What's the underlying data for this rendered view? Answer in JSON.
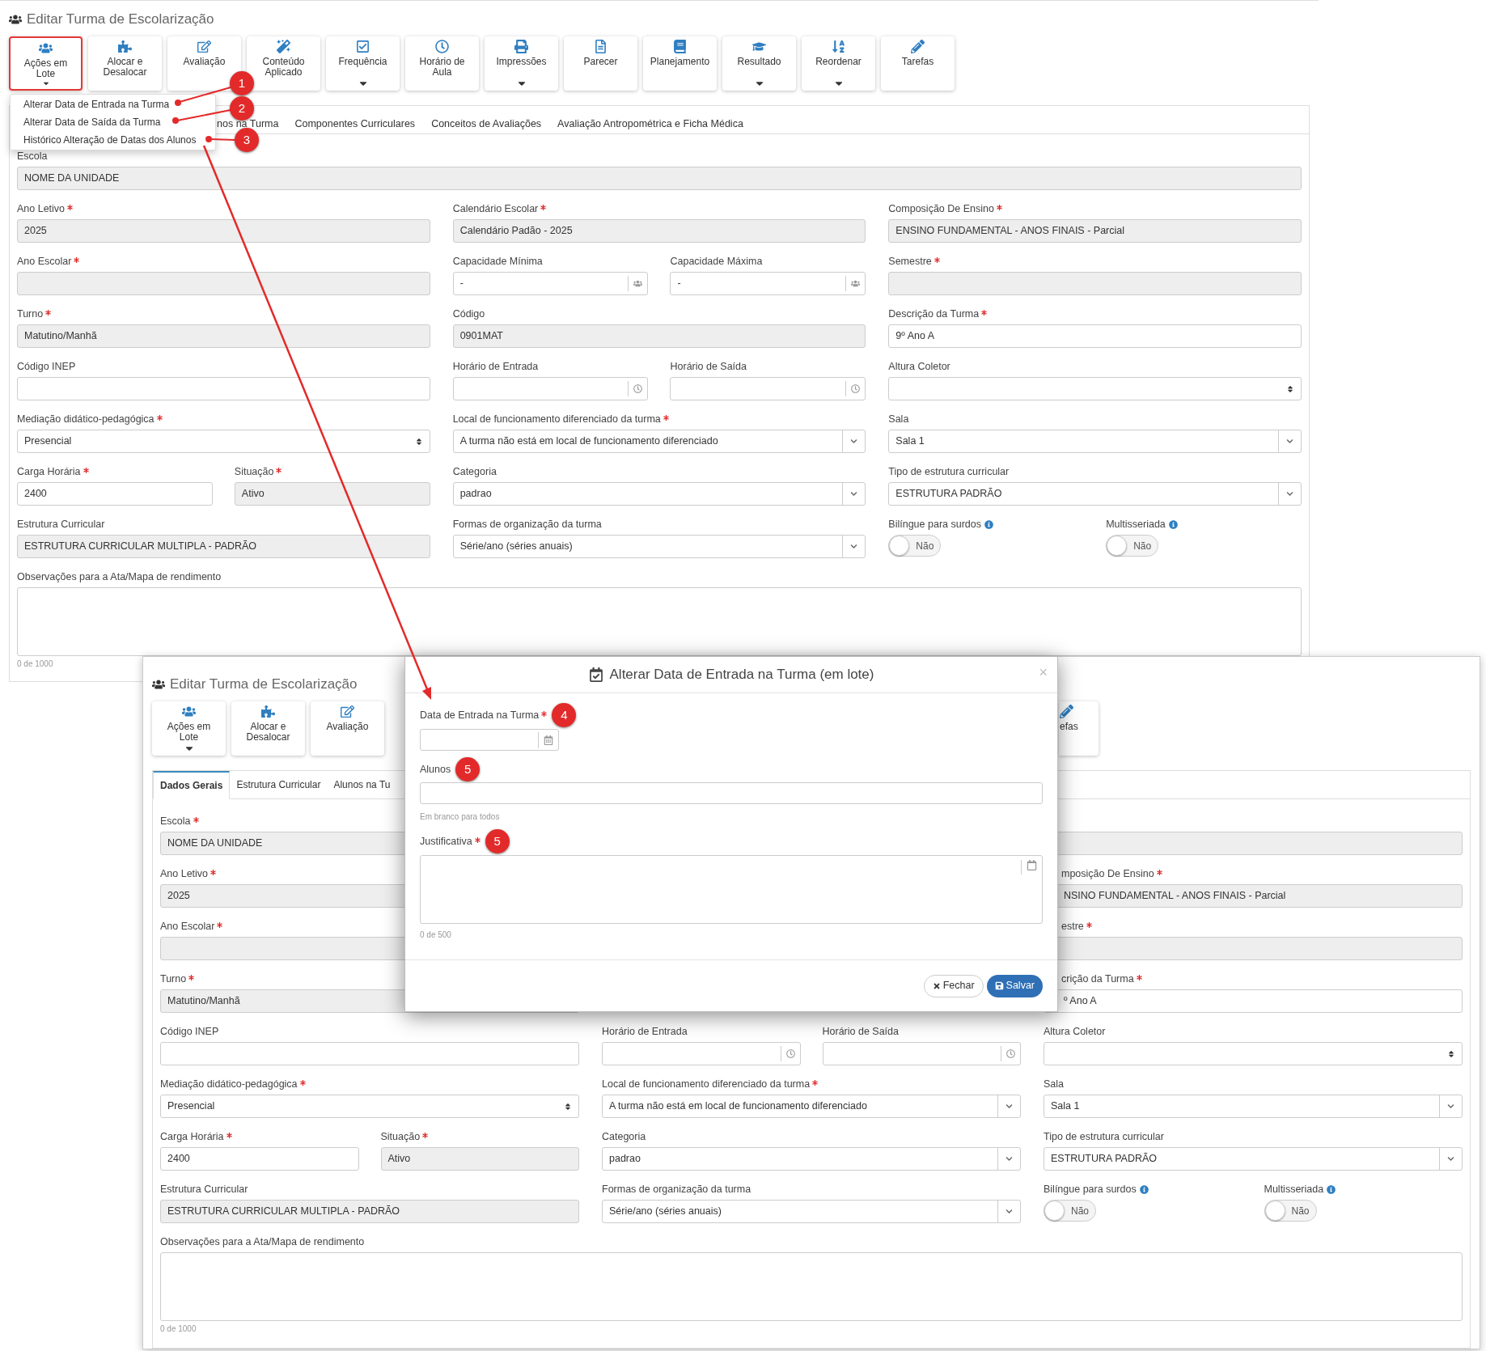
{
  "screens": [
    {
      "title": "Editar Turma de Escolarização",
      "toolbar": [
        {
          "label": "Ações em Lote",
          "dropdown": true,
          "highlighted": true
        },
        {
          "label": "Alocar e Desalocar",
          "dropdown": false,
          "highlighted": false
        },
        {
          "label": "Avaliação",
          "dropdown": false,
          "highlighted": false
        },
        {
          "label": "Conteúdo Aplicado",
          "dropdown": false,
          "highlighted": false
        },
        {
          "label": "Frequência",
          "dropdown": true,
          "highlighted": false
        },
        {
          "label": "Horário de Aula",
          "dropdown": false,
          "highlighted": false
        },
        {
          "label": "Impressões",
          "dropdown": true,
          "highlighted": false
        },
        {
          "label": "Parecer",
          "dropdown": false,
          "highlighted": false
        },
        {
          "label": "Planejamento",
          "dropdown": false,
          "highlighted": false
        },
        {
          "label": "Resultado",
          "dropdown": true,
          "highlighted": false
        },
        {
          "label": "Reordenar",
          "dropdown": true,
          "highlighted": false
        },
        {
          "label": "Tarefas",
          "dropdown": false,
          "highlighted": false
        }
      ],
      "menu": {
        "items": [
          "Alterar Data de Entrada na Turma",
          "Alterar Data de Saída da Turma",
          "Histórico Alteração de Datas dos Alunos"
        ]
      },
      "tabs": [
        {
          "label": "nos na Turma",
          "selected": false
        },
        {
          "label": "Componentes Curriculares",
          "selected": false
        },
        {
          "label": "Conceitos de Avaliações",
          "selected": false
        },
        {
          "label": "Avaliação Antropométrica e Ficha Médica",
          "selected": false
        }
      ],
      "escola": {
        "label": "Escola",
        "required": false,
        "kind": "input",
        "value": "NOME DA UNIDADE",
        "disabled": true
      },
      "rows": [
        {
          "col1": [
            {
              "label": "Ano Letivo",
              "required": true,
              "kind": "input",
              "value": "2025",
              "disabled": true
            }
          ],
          "col2": [
            {
              "label": "Calendário Escolar",
              "required": true,
              "kind": "input",
              "value": "Calendário Padão - 2025",
              "disabled": true
            }
          ],
          "col3": [
            {
              "label": "Composição De Ensino",
              "required": true,
              "kind": "input",
              "value": "ENSINO FUNDAMENTAL - ANOS FINAIS - Parcial",
              "disabled": true
            }
          ]
        },
        {
          "col1": [
            {
              "label": "Ano Escolar",
              "required": true,
              "kind": "input",
              "disabled": true
            }
          ],
          "col2": [
            {
              "label": "Capacidade Mínima",
              "required": false,
              "kind": "people",
              "value": "-",
              "disabled": false
            },
            {
              "label": "Capacidade Máxima",
              "required": false,
              "kind": "people",
              "value": "-",
              "disabled": false
            }
          ],
          "col3": [
            {
              "label": "Semestre",
              "required": true,
              "kind": "input",
              "disabled": true
            }
          ]
        },
        {
          "col1": [
            {
              "label": "Turno",
              "required": true,
              "kind": "input",
              "value": "Matutino/Manhã",
              "disabled": true
            }
          ],
          "col2": [
            {
              "label": "Código",
              "required": false,
              "kind": "input",
              "value": "0901MAT",
              "disabled": true
            }
          ],
          "col3": [
            {
              "label": "Descrição da Turma",
              "required": true,
              "kind": "input",
              "value": "9º Ano A",
              "disabled": false
            }
          ]
        },
        {
          "col1": [
            {
              "label": "Código INEP",
              "required": false,
              "kind": "input",
              "disabled": false
            }
          ],
          "col2": [
            {
              "label": "Horário de Entrada",
              "required": false,
              "kind": "clock",
              "disabled": false
            },
            {
              "label": "Horário de Saída",
              "required": false,
              "kind": "clock",
              "disabled": false
            }
          ],
          "col3": [
            {
              "label": "Altura Coletor",
              "required": false,
              "kind": "spinner",
              "disabled": false
            }
          ]
        },
        {
          "col1": [
            {
              "label": "Mediação didático-pedagógica",
              "required": true,
              "kind": "spinner",
              "value": "Presencial",
              "disabled": false
            }
          ],
          "col2": [
            {
              "label": "Local de funcionamento diferenciado da turma",
              "required": true,
              "kind": "select",
              "value": "A turma não está em local de funcionamento diferenciado",
              "disabled": false
            }
          ],
          "col3": [
            {
              "label": "Sala",
              "required": false,
              "kind": "select",
              "value": "Sala 1",
              "disabled": false
            }
          ]
        },
        {
          "col1": [
            {
              "label": "Carga Horária",
              "required": true,
              "kind": "input",
              "value": "2400",
              "disabled": false
            },
            {
              "label": "Situação",
              "required": true,
              "kind": "input",
              "value": "Ativo",
              "disabled": true
            }
          ],
          "col2": [
            {
              "label": "Categoria",
              "required": false,
              "kind": "select",
              "value": "padrao",
              "disabled": false
            }
          ],
          "col3": [
            {
              "label": "Tipo de estrutura curricular",
              "required": false,
              "kind": "select",
              "value": "ESTRUTURA PADRÃO",
              "disabled": false
            }
          ]
        },
        {
          "col1": [
            {
              "label": "Estrutura Curricular",
              "required": false,
              "kind": "input",
              "value": "ESTRUTURA CURRICULAR MULTIPLA - PADRÃO",
              "disabled": true
            }
          ],
          "col2": [
            {
              "label": "Formas de organização da turma",
              "required": false,
              "kind": "select",
              "value": "Série/ano (séries anuais)",
              "disabled": false
            }
          ],
          "col3": [
            {
              "label": "Bilíngue para surdos",
              "required": false,
              "info": true,
              "kind": "toggle",
              "value": "Não",
              "on": false
            },
            {
              "label": "Multisseriada",
              "required": false,
              "info": true,
              "kind": "toggle",
              "value": "Não",
              "on": false
            }
          ]
        }
      ],
      "observacoes": {
        "label": "Observações para a Ata/Mapa de rendimento",
        "required": false,
        "kind": "textarea",
        "counter": "0 de 1000"
      }
    },
    {
      "title": "Editar Turma de Escolarização",
      "toolbar": [
        {
          "label": "Ações em Lote",
          "dropdown": true,
          "highlighted": false
        },
        {
          "label": "Alocar e Desalocar",
          "dropdown": false,
          "highlighted": false
        },
        {
          "label": "Avaliação",
          "dropdown": false,
          "highlighted": false
        },
        {
          "label": "efas",
          "dropdown": false,
          "highlighted": false
        }
      ],
      "tabs": [
        {
          "label": "Dados Gerais",
          "selected": true
        },
        {
          "label": "Estrutura Curricular",
          "selected": false
        },
        {
          "label": "Alunos na Tu",
          "selected": false
        }
      ],
      "escola": {
        "label": "Escola",
        "required": true,
        "kind": "input",
        "value": "NOME DA UNIDADE",
        "disabled": true
      },
      "rows": [
        {
          "col1": [
            {
              "label": "Ano Letivo",
              "required": true,
              "kind": "input",
              "value": "2025",
              "disabled": true
            }
          ],
          "col3": [
            {
              "label": "mposição De Ensino",
              "required": true,
              "kind": "input",
              "value": "NSINO FUNDAMENTAL - ANOS FINAIS - Parcial",
              "disabled": true
            }
          ]
        },
        {
          "col1": [
            {
              "label": "Ano Escolar",
              "required": true,
              "kind": "input",
              "disabled": true
            }
          ],
          "col3": [
            {
              "label": "estre",
              "required": true,
              "kind": "input",
              "disabled": true
            }
          ]
        },
        {
          "col1": [
            {
              "label": "Turno",
              "required": true,
              "kind": "input",
              "value": "Matutino/Manhã",
              "disabled": true
            }
          ],
          "col3": [
            {
              "label": "crição da Turma",
              "required": true,
              "kind": "input",
              "value": "º Ano A",
              "disabled": false
            }
          ]
        },
        {
          "col1": [
            {
              "label": "Código INEP",
              "required": false,
              "kind": "input",
              "disabled": false
            }
          ],
          "col2": [
            {
              "label": "Horário de Entrada",
              "required": false,
              "kind": "clock",
              "disabled": false
            },
            {
              "label": "Horário de Saída",
              "required": false,
              "kind": "clock",
              "disabled": false
            }
          ],
          "col3": [
            {
              "label": "Altura Coletor",
              "required": false,
              "kind": "spinner",
              "disabled": false
            }
          ]
        },
        {
          "col1": [
            {
              "label": "Mediação didático-pedagógica",
              "required": true,
              "kind": "spinner",
              "value": "Presencial",
              "disabled": false
            }
          ],
          "col2": [
            {
              "label": "Local de funcionamento diferenciado da turma",
              "required": true,
              "kind": "select",
              "value": "A turma não está em local de funcionamento diferenciado",
              "disabled": false
            }
          ],
          "col3": [
            {
              "label": "Sala",
              "required": false,
              "kind": "select",
              "value": "Sala 1",
              "disabled": false
            }
          ]
        },
        {
          "col1": [
            {
              "label": "Carga Horária",
              "required": true,
              "kind": "input",
              "value": "2400",
              "disabled": false
            },
            {
              "label": "Situação",
              "required": true,
              "kind": "input",
              "value": "Ativo",
              "disabled": true
            }
          ],
          "col2": [
            {
              "label": "Categoria",
              "required": false,
              "kind": "select",
              "value": "padrao",
              "disabled": false
            }
          ],
          "col3": [
            {
              "label": "Tipo de estrutura curricular",
              "required": false,
              "kind": "select",
              "value": "ESTRUTURA PADRÃO",
              "disabled": false
            }
          ]
        },
        {
          "col1": [
            {
              "label": "Estrutura Curricular",
              "required": false,
              "kind": "input",
              "value": "ESTRUTURA CURRICULAR MULTIPLA - PADRÃO",
              "disabled": true
            }
          ],
          "col2": [
            {
              "label": "Formas de organização da turma",
              "required": false,
              "kind": "select",
              "value": "Série/ano (séries anuais)",
              "disabled": false
            }
          ],
          "col3": [
            {
              "label": "Bilíngue para surdos",
              "required": false,
              "info": true,
              "kind": "toggle",
              "value": "Não",
              "on": false
            },
            {
              "label": "Multisseriada",
              "required": false,
              "info": true,
              "kind": "toggle",
              "value": "Não",
              "on": false
            }
          ]
        }
      ],
      "observacoes": {
        "label": "Observações para a Ata/Mapa de rendimento",
        "required": false,
        "kind": "textarea",
        "counter": "0 de 1000"
      }
    }
  ],
  "dialog": {
    "title": "Alterar Data de Entrada na Turma (em lote)",
    "close": "×",
    "fields": [
      {
        "label": "Data de Entrada na Turma",
        "required": true,
        "badge": "4",
        "kind": "date"
      },
      {
        "label": "Alunos",
        "required": false,
        "badge": "5",
        "kind": "input",
        "help": "Em branco para todos"
      },
      {
        "label": "Justificativa",
        "required": true,
        "badge": "5",
        "kind": "textarea",
        "counter": "0 de 500"
      }
    ],
    "buttons": [
      {
        "label": "Fechar",
        "kind": "close"
      },
      {
        "label": "Salvar",
        "kind": "save"
      }
    ]
  },
  "annotations": [
    {
      "number": "1"
    },
    {
      "number": "2"
    },
    {
      "number": "3"
    }
  ]
}
